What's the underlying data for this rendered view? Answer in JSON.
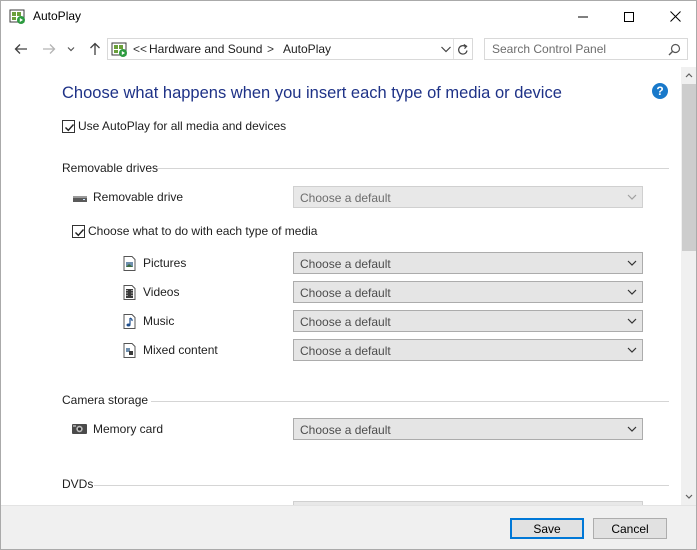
{
  "window": {
    "title": "AutoPlay"
  },
  "address": {
    "overflow": "<<",
    "crumbs": [
      "Hardware and Sound",
      "AutoPlay"
    ],
    "separator": ">"
  },
  "search": {
    "placeholder": "Search Control Panel"
  },
  "main": {
    "title": "Choose what happens when you insert each type of media or device",
    "help": "?",
    "use_autoplay": {
      "label": "Use AutoPlay for all media and devices",
      "checked": true
    },
    "sections": [
      {
        "title": "Removable drives",
        "device": {
          "label": "Removable drive",
          "icon": "removable-drive-icon",
          "value": "Choose a default",
          "enabled": false
        },
        "media_checkbox": {
          "label": "Choose what to do with each type of media",
          "checked": true
        },
        "media": [
          {
            "label": "Pictures",
            "icon": "pictures-icon",
            "value": "Choose a default"
          },
          {
            "label": "Videos",
            "icon": "videos-icon",
            "value": "Choose a default"
          },
          {
            "label": "Music",
            "icon": "music-icon",
            "value": "Choose a default"
          },
          {
            "label": "Mixed content",
            "icon": "mixed-content-icon",
            "value": "Choose a default"
          }
        ]
      },
      {
        "title": "Camera storage",
        "device": {
          "label": "Memory card",
          "icon": "memory-card-icon",
          "value": "Choose a default",
          "enabled": true
        }
      },
      {
        "title": "DVDs"
      }
    ]
  },
  "footer": {
    "save_label": "Save",
    "cancel_label": "Cancel"
  },
  "colors": {
    "title": "#1e3287",
    "accent": "#0078d7",
    "help": "#1979ca"
  }
}
